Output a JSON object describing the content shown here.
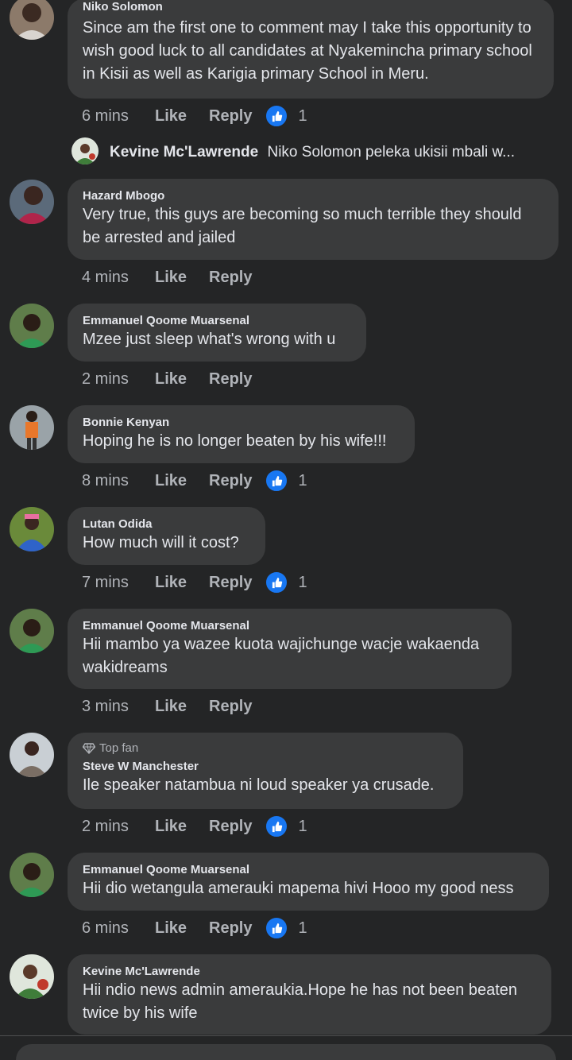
{
  "comments": [
    {
      "author": "Niko Solomon",
      "text": "Since am the first one to comment may I take this opportunity to wish good luck to all candidates at Nyakemincha primary school in Kisii as well as Karigia primary School in Meru.",
      "time": "6 mins",
      "like_label": "Like",
      "reply_label": "Reply",
      "reactions": "1",
      "reply_preview": {
        "author": "Kevine Mc'Lawrende",
        "text": "Niko Solomon peleka ukisii mbali w..."
      }
    },
    {
      "author": "Hazard Mbogo",
      "text": "Very true, this guys are becoming so much terrible they should be arrested and jailed",
      "time": "4 mins",
      "like_label": "Like",
      "reply_label": "Reply"
    },
    {
      "author": "Emmanuel Qoome Muarsenal",
      "text": "Mzee just sleep what's wrong with u",
      "time": "2 mins",
      "like_label": "Like",
      "reply_label": "Reply"
    },
    {
      "author": "Bonnie Kenyan",
      "text": "Hoping he is no longer beaten by his wife!!!",
      "time": "8 mins",
      "like_label": "Like",
      "reply_label": "Reply",
      "reactions": "1"
    },
    {
      "author": "Lutan Odida",
      "text": "How much will it cost?",
      "time": "7 mins",
      "like_label": "Like",
      "reply_label": "Reply",
      "reactions": "1"
    },
    {
      "author": "Emmanuel Qoome Muarsenal",
      "text": "Hii mambo ya wazee kuota wajichunge wacje wakaenda wakidreams",
      "time": "3 mins",
      "like_label": "Like",
      "reply_label": "Reply"
    },
    {
      "badge": "Top fan",
      "author": "Steve W Manchester",
      "text": "Ile speaker natambua ni loud speaker ya crusade.",
      "time": "2 mins",
      "like_label": "Like",
      "reply_label": "Reply",
      "reactions": "1"
    },
    {
      "author": "Emmanuel Qoome Muarsenal",
      "text": "Hii dio wetangula amerauki mapema hivi Hooo my good ness",
      "time": "6 mins",
      "like_label": "Like",
      "reply_label": "Reply",
      "reactions": "1"
    },
    {
      "author": "Kevine Mc'Lawrende",
      "text": "Hii ndio news admin ameraukia.Hope he has not been beaten twice by his wife"
    }
  ],
  "colors": {
    "background": "#242526",
    "bubble": "#3a3b3c",
    "primary_text": "#e4e6eb",
    "secondary_text": "#b0b3b8",
    "like_reaction": "#1877f2"
  },
  "icons": {
    "like_reaction": "thumbs-up-icon",
    "top_fan": "diamond-icon"
  }
}
